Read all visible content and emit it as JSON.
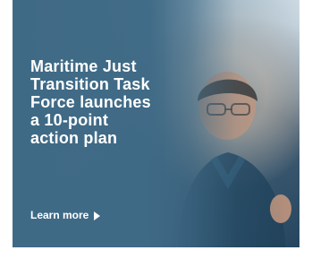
{
  "ad": {
    "headline": "Maritime Just\nTransition Task\nForce launches\na 10-point\naction plan",
    "cta_label": "Learn more",
    "cta_icon": "chevron-right-icon"
  },
  "colors": {
    "panel": "#3f6a86",
    "text": "#ffffff"
  }
}
